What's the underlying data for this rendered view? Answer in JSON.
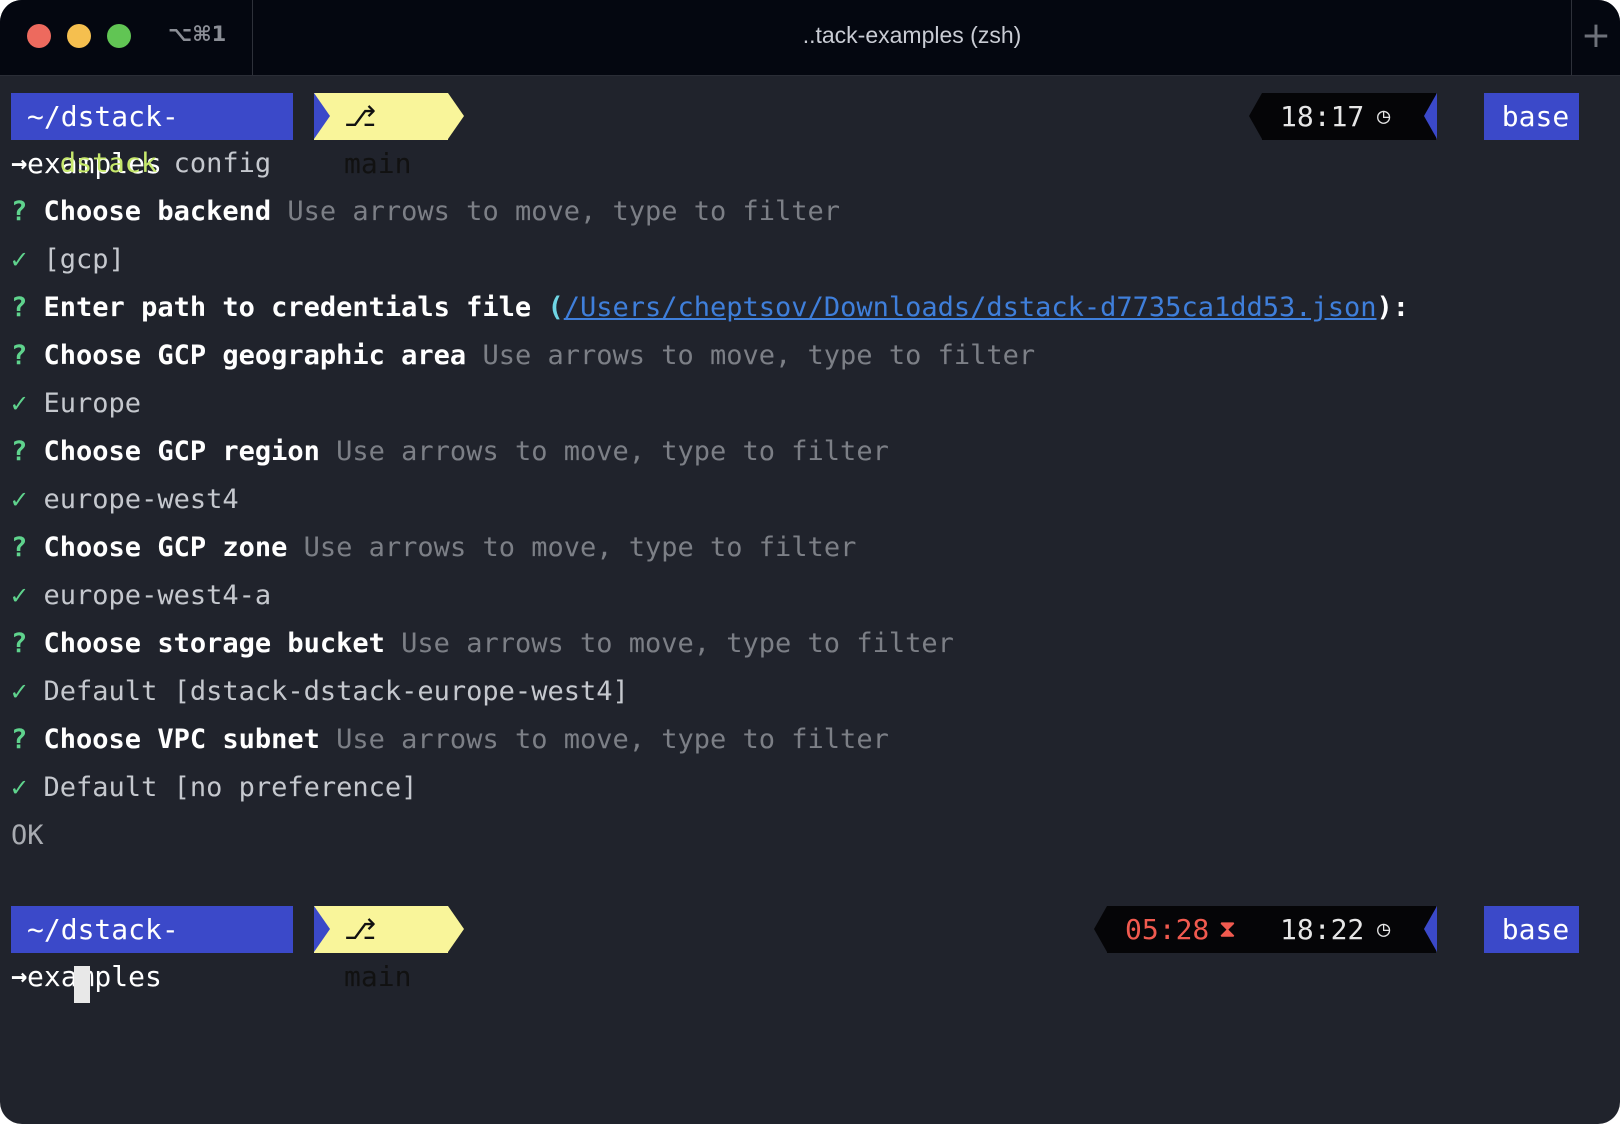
{
  "window": {
    "shortcut": "⌥⌘1",
    "title": "..tack-examples (zsh)",
    "new_tab": "+"
  },
  "prompt1": {
    "path": "~/dstack-examples",
    "branch_icon": "⎇",
    "branch": "main",
    "time": "18:17",
    "clock_icon": "◷",
    "env": "base"
  },
  "command": {
    "arrow": "→",
    "program": "dstack",
    "args": "config"
  },
  "output": [
    {
      "kind": "question",
      "marker": "?",
      "label": "Choose backend",
      "hint": "Use arrows to move, type to filter"
    },
    {
      "kind": "answer",
      "marker": "✓",
      "value": "[gcp]"
    },
    {
      "kind": "path",
      "marker": "?",
      "label": "Enter path to credentials file",
      "open": "(",
      "path": "/Users/cheptsov/Downloads/dstack-d7735ca1dd53.json",
      "close": "):"
    },
    {
      "kind": "question",
      "marker": "?",
      "label": "Choose GCP geographic area",
      "hint": "Use arrows to move, type to filter"
    },
    {
      "kind": "answer",
      "marker": "✓",
      "value": "Europe"
    },
    {
      "kind": "question",
      "marker": "?",
      "label": "Choose GCP region",
      "hint": "Use arrows to move, type to filter"
    },
    {
      "kind": "answer",
      "marker": "✓",
      "value": "europe-west4"
    },
    {
      "kind": "question",
      "marker": "?",
      "label": "Choose GCP zone",
      "hint": "Use arrows to move, type to filter"
    },
    {
      "kind": "answer",
      "marker": "✓",
      "value": "europe-west4-a"
    },
    {
      "kind": "question",
      "marker": "?",
      "label": "Choose storage bucket",
      "hint": "Use arrows to move, type to filter"
    },
    {
      "kind": "answer",
      "marker": "✓",
      "value": "Default [dstack-dstack-europe-west4]"
    },
    {
      "kind": "question",
      "marker": "?",
      "label": "Choose VPC subnet",
      "hint": "Use arrows to move, type to filter"
    },
    {
      "kind": "answer",
      "marker": "✓",
      "value": "Default [no preference]"
    },
    {
      "kind": "status",
      "value": "OK"
    }
  ],
  "prompt2": {
    "path": "~/dstack-examples",
    "branch_icon": "⎇",
    "branch": "main",
    "duration": "05:28",
    "hourglass_icon": "⧗",
    "time": "18:22",
    "clock_icon": "◷",
    "env": "base",
    "arrow": "→"
  },
  "colors": {
    "background": "#20232c",
    "titlebar": "#040710",
    "path_segment": "#3b49c9",
    "branch_segment": "#f9f59a",
    "check": "#5fd38d",
    "program": "#c6e86c",
    "link": "#3f7fdb",
    "duration": "#f05a4f"
  }
}
